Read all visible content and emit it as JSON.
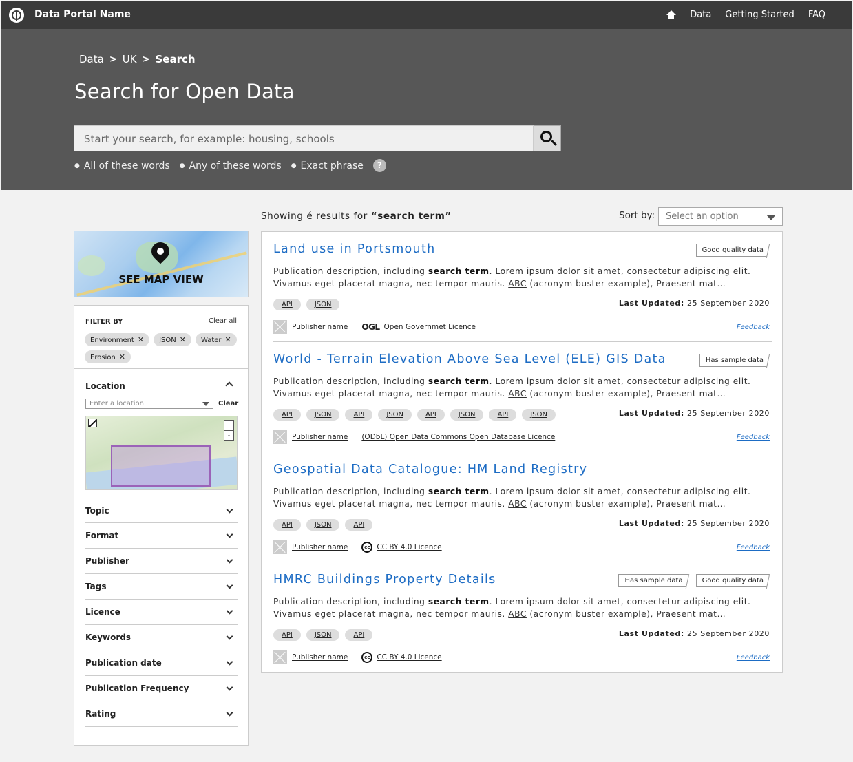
{
  "header": {
    "portal_name": "Data Portal Name",
    "nav": [
      "Data",
      "Getting Started",
      "FAQ"
    ]
  },
  "hero": {
    "breadcrumb": [
      "Data",
      "UK",
      "Search"
    ],
    "title": "Search for Open Data",
    "search_placeholder": "Start your search, for example: housing, schools",
    "modes": [
      "All of these words",
      "Any of these words",
      "Exact phrase"
    ],
    "help": "?"
  },
  "sidebar": {
    "map_view_label": "SEE MAP VIEW",
    "filter_by": "FILTER BY",
    "clear_all": "Clear all",
    "active_filters": [
      "Environment",
      "JSON",
      "Water",
      "Erosion"
    ],
    "location": {
      "title": "Location",
      "placeholder": "Enter a location",
      "clear": "Clear",
      "zoom_in": "+",
      "zoom_out": "-"
    },
    "facets": [
      "Topic",
      "Format",
      "Publisher",
      "Tags",
      "Licence",
      "Keywords",
      "Publication date",
      "Publication Frequency",
      "Rating"
    ]
  },
  "results": {
    "summary_prefix": "Showing é results for",
    "search_term": "“search term”",
    "sort_label": "Sort by:",
    "sort_value": "Select an option",
    "items": [
      {
        "title": "Land use in Portsmouth",
        "badges": [
          "Good quality data"
        ],
        "desc_a": "Publication description, including ",
        "desc_term": "search term",
        "desc_b": ". Lorem ipsum dolor sit amet, consectetur adipiscing elit. Vivamus eget placerat magna, nec tempor mauris. ",
        "desc_abbr": "ABC",
        "desc_c": " (acronym buster example), Praesent mat…",
        "formats": [
          "API",
          "JSON"
        ],
        "updated_label": "Last Updated:",
        "updated_date": "25 September 2020",
        "publisher": "Publisher name",
        "licence_icon": "OGL",
        "licence": "Open Governmet Licence",
        "feedback": "Feedback"
      },
      {
        "title": "World - Terrain Elevation Above Sea Level (ELE) GIS Data",
        "badges": [
          "Has sample data"
        ],
        "desc_a": "Publication description, including ",
        "desc_term": "search term",
        "desc_b": ". Lorem ipsum dolor sit amet, consectetur adipiscing elit. Vivamus eget placerat magna, nec tempor mauris. ",
        "desc_abbr": "ABC",
        "desc_c": " (acronym buster example), Praesent mat…",
        "formats": [
          "API",
          "JSON",
          "API",
          "JSON",
          "API",
          "JSON",
          "API",
          "JSON"
        ],
        "updated_label": "Last Updated:",
        "updated_date": "25 September 2020",
        "publisher": "Publisher name",
        "licence_icon": "",
        "licence": "(ODbL) Open Data Commons Open Database Licence",
        "feedback": "Feedback"
      },
      {
        "title": "Geospatial Data Catalogue: HM Land Registry",
        "badges": [],
        "desc_a": "Publication description, including ",
        "desc_term": "search term",
        "desc_b": ". Lorem ipsum dolor sit amet, consectetur adipiscing elit. Vivamus eget placerat magna, nec tempor mauris. ",
        "desc_abbr": "ABC",
        "desc_c": " (acronym buster example), Praesent mat…",
        "formats": [
          "API",
          "JSON",
          "API"
        ],
        "updated_label": "Last Updated:",
        "updated_date": "25 September 2020",
        "publisher": "Publisher name",
        "licence_icon": "cc",
        "licence": "CC BY 4.0 Licence",
        "feedback": "Feedback"
      },
      {
        "title": "HMRC Buildings Property Details",
        "badges": [
          "Has sample data",
          "Good quality data"
        ],
        "desc_a": "Publication description, including ",
        "desc_term": "search term",
        "desc_b": ". Lorem ipsum dolor sit amet, consectetur adipiscing elit. Vivamus eget placerat magna, nec tempor mauris. ",
        "desc_abbr": "ABC",
        "desc_c": " (acronym buster example), Praesent mat…",
        "formats": [
          "API",
          "JSON",
          "API"
        ],
        "updated_label": "Last Updated:",
        "updated_date": "25 September 2020",
        "publisher": "Publisher name",
        "licence_icon": "cc",
        "licence": "CC BY 4.0 Licence",
        "feedback": "Feedback"
      }
    ]
  }
}
